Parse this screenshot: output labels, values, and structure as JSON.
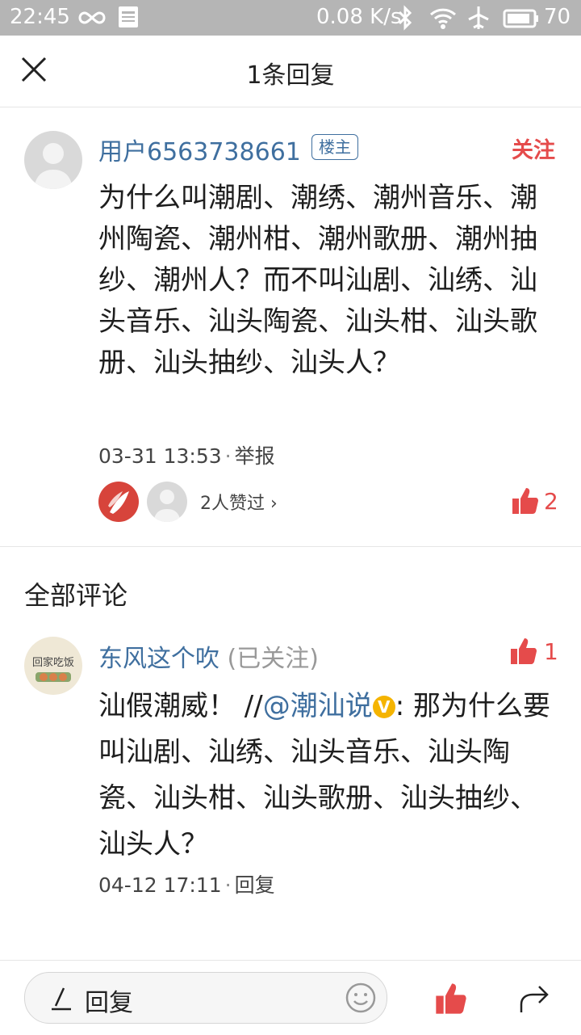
{
  "status_bar": {
    "time": "22:45",
    "net_speed": "0.08 K/s",
    "battery": "70",
    "icons": [
      "infinity-icon",
      "news-icon",
      "bluetooth-icon",
      "wifi-icon",
      "airplane-icon",
      "battery-icon"
    ]
  },
  "header": {
    "title": "1条回复",
    "close_icon": "close-icon"
  },
  "post": {
    "username": "用户6563738661",
    "badge": "楼主",
    "follow_label": "关注",
    "text": "为什么叫潮剧、潮绣、潮州音乐、潮州陶瓷、潮州柑、潮州歌册、潮州抽纱、潮州人？而不叫汕剧、汕绣、汕头音乐、汕头陶瓷、汕头柑、汕头歌册、汕头抽纱、汕头人？",
    "time": "03-31 13:53",
    "report_label": "举报",
    "likers_text": "2人赞过 ›",
    "like_count": "2"
  },
  "comments_section": {
    "title": "全部评论",
    "items": [
      {
        "author": "东风这个吹",
        "followed_label": "(已关注)",
        "like_count": "1",
        "text_prefix": "汕假潮威！ //",
        "mention": "@潮汕说",
        "verified_mark": "V",
        "text_suffix": ": 那为什么要叫汕剧、汕绣、汕头音乐、汕头陶瓷、汕头柑、汕头歌册、汕头抽纱、汕头人？",
        "time": "04-12 17:11",
        "reply_label": "回复",
        "avatar_text": "回家吃饭"
      }
    ]
  },
  "bottom_bar": {
    "reply_placeholder": "回复",
    "icons": [
      "pen-icon",
      "emoji-icon",
      "thumbs-up-icon",
      "share-icon"
    ]
  },
  "colors": {
    "accent_red": "#e54b4b",
    "link_blue": "#3f6f9f",
    "status_bar_bg": "#b5b5b5",
    "verified_yellow": "#f5b400"
  }
}
